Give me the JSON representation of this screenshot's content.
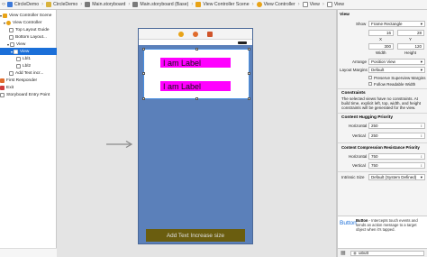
{
  "jumpbar": {
    "crumbs": [
      {
        "label": "CircleDemo",
        "color": "#3c79d8"
      },
      {
        "label": "CircleDemo",
        "color": "#d8b23c"
      },
      {
        "label": "Main.storyboard",
        "color": "#7a7a7a"
      },
      {
        "label": "Main.storyboard (Base)",
        "color": "#7a7a7a"
      },
      {
        "label": "View Controller Scene",
        "color": "#e8a317"
      },
      {
        "label": "View Controller",
        "color": "#e8a317"
      },
      {
        "label": "View",
        "color": "#ffffff"
      },
      {
        "label": "View",
        "color": "#ffffff"
      }
    ]
  },
  "outline": {
    "items": [
      {
        "label": "View Controller Scene",
        "icon": "scene-icon"
      },
      {
        "label": "View Controller",
        "icon": "view-controller-icon"
      },
      {
        "label": "Top Layout Guide",
        "icon": "layout-guide-icon"
      },
      {
        "label": "Bottom Layout...",
        "icon": "layout-guide-icon"
      },
      {
        "label": "View",
        "icon": "view-icon"
      },
      {
        "label": "View",
        "icon": "view-icon"
      },
      {
        "label": "Lbl1",
        "icon": "label-icon"
      },
      {
        "label": "Lbl2",
        "icon": "label-icon"
      },
      {
        "label": "Add Text incr...",
        "icon": "button-icon"
      },
      {
        "label": "First Responder",
        "icon": "first-responder-icon"
      },
      {
        "label": "Exit",
        "icon": "exit-icon"
      },
      {
        "label": "Storyboard Entry Point",
        "icon": "entry-point-icon"
      }
    ]
  },
  "canvas": {
    "label1": "I am Label",
    "label2": "I am Label",
    "button": "Add Text Increase size",
    "colors": {
      "view_bg": "#5b80ba",
      "label_bg": "#ff00ff",
      "button_bg": "#6a5d0f"
    }
  },
  "inspector": {
    "section": "View",
    "show_label": "Show",
    "show_value": "Frame Rectangle",
    "x": "16",
    "y": "28",
    "x_label": "X",
    "y_label": "Y",
    "width": "300",
    "height": "120",
    "width_label": "Width",
    "height_label": "Height",
    "arrange_label": "Arrange",
    "arrange_value": "Position View",
    "layout_margins_label": "Layout Margins",
    "layout_margins_value": "Default",
    "preserve_label": "Preserve Superview Margins",
    "follow_label": "Follow Readable Width",
    "constraints_title": "Constraints",
    "constraints_text": "The selected views have no constraints. At build time, explicit left, top, width, and height constraints will be generated for the view.",
    "hugging_title": "Content Hugging Priority",
    "horizontal_label": "Horizontal",
    "vertical_label": "Vertical",
    "hugging_h": "250",
    "hugging_v": "250",
    "compression_title": "Content Compression Resistance Priority",
    "compression_h": "750",
    "compression_v": "750",
    "intrinsic_label": "Intrinsic Size",
    "intrinsic_value": "Default (System Defined)",
    "library_icon_text": "Button",
    "library_title": "Button",
    "library_desc": " - Intercepts touch events and sends an action message to a target object when it's tapped.",
    "filter_text": "uibutt"
  }
}
